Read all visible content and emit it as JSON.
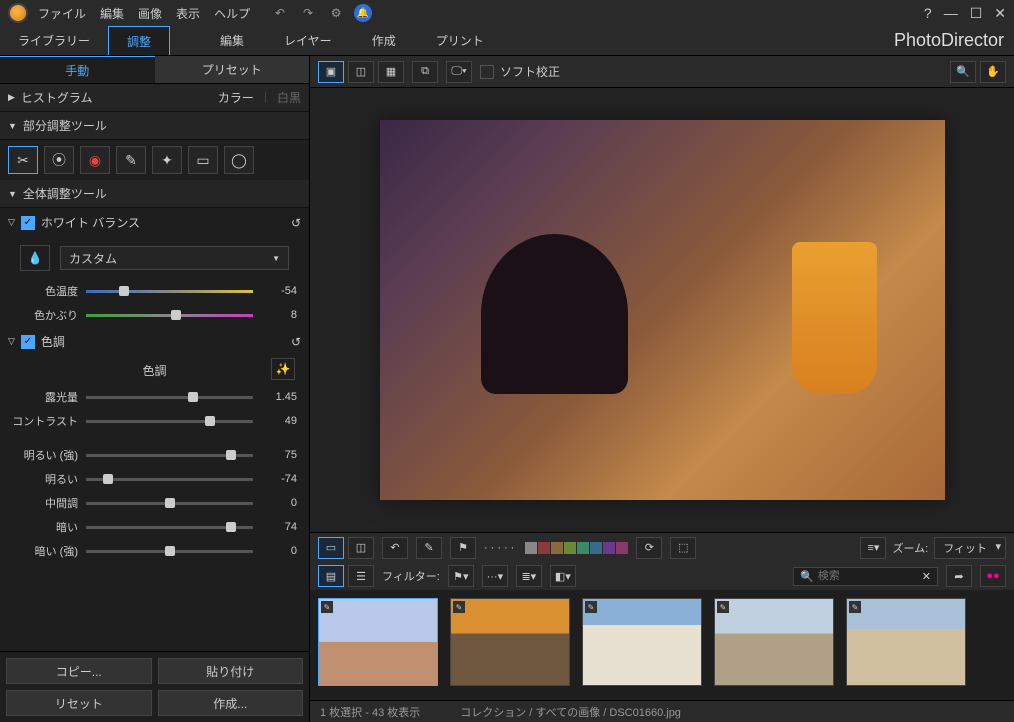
{
  "menu": {
    "file": "ファイル",
    "edit": "編集",
    "image": "画像",
    "view": "表示",
    "help": "ヘルプ"
  },
  "window": {
    "help": "?",
    "min": "—",
    "max": "☐",
    "close": "✕"
  },
  "modes": {
    "library": "ライブラリー",
    "adjustment": "調整",
    "edit": "編集",
    "layer": "レイヤー",
    "create": "作成",
    "print": "プリント"
  },
  "brand": "PhotoDirector",
  "subtabs": {
    "manual": "手動",
    "preset": "プリセット"
  },
  "histogram": {
    "label": "ヒストグラム",
    "color": "カラー",
    "bw": "白黒"
  },
  "regional": {
    "label": "部分調整ツール"
  },
  "global": {
    "label": "全体調整ツール"
  },
  "wb": {
    "label": "ホワイト バランス",
    "preset": "カスタム",
    "temp_label": "色温度",
    "temp_val": "-54",
    "tint_label": "色かぶり",
    "tint_val": "8"
  },
  "tone": {
    "label": "色調",
    "heading": "色調",
    "exposure_label": "露光量",
    "exposure_val": "1.45",
    "contrast_label": "コントラスト",
    "contrast_val": "49",
    "hi_strong_label": "明るい (強)",
    "hi_strong_val": "75",
    "hi_label": "明るい",
    "hi_val": "-74",
    "mid_label": "中間調",
    "mid_val": "0",
    "lo_label": "暗い",
    "lo_val": "74",
    "lo_strong_label": "暗い (強)",
    "lo_strong_val": "0"
  },
  "buttons": {
    "copy": "コピー...",
    "paste": "貼り付け",
    "reset": "リセット",
    "create": "作成..."
  },
  "softproof": "ソフト校正",
  "zoom": {
    "label": "ズーム:",
    "value": "フィット"
  },
  "filter": {
    "label": "フィルター:"
  },
  "search": {
    "placeholder": "検索"
  },
  "status": {
    "text": "1 枚選択 - 43 枚表示",
    "breadcrumb": "コレクション / すべての画像 / DSC01660.jpg"
  },
  "swatches": [
    "#888",
    "#8a3a3a",
    "#8a6a3a",
    "#6a8a3a",
    "#3a8a6a",
    "#3a6a8a",
    "#6a3a8a",
    "#8a3a6a"
  ],
  "thumbs": [
    {
      "bg": "linear-gradient(#b8c8e8 50%,#c09070 50%)"
    },
    {
      "bg": "linear-gradient(#d89030 40%,#705840 40%)"
    },
    {
      "bg": "linear-gradient(#8ab0d8 30%,#e8e0d0 30%)"
    },
    {
      "bg": "linear-gradient(#c0d0e0 40%,#b0a088 40%)"
    },
    {
      "bg": "linear-gradient(#a8c0d8 35%,#d0c0a0 35%)"
    }
  ]
}
